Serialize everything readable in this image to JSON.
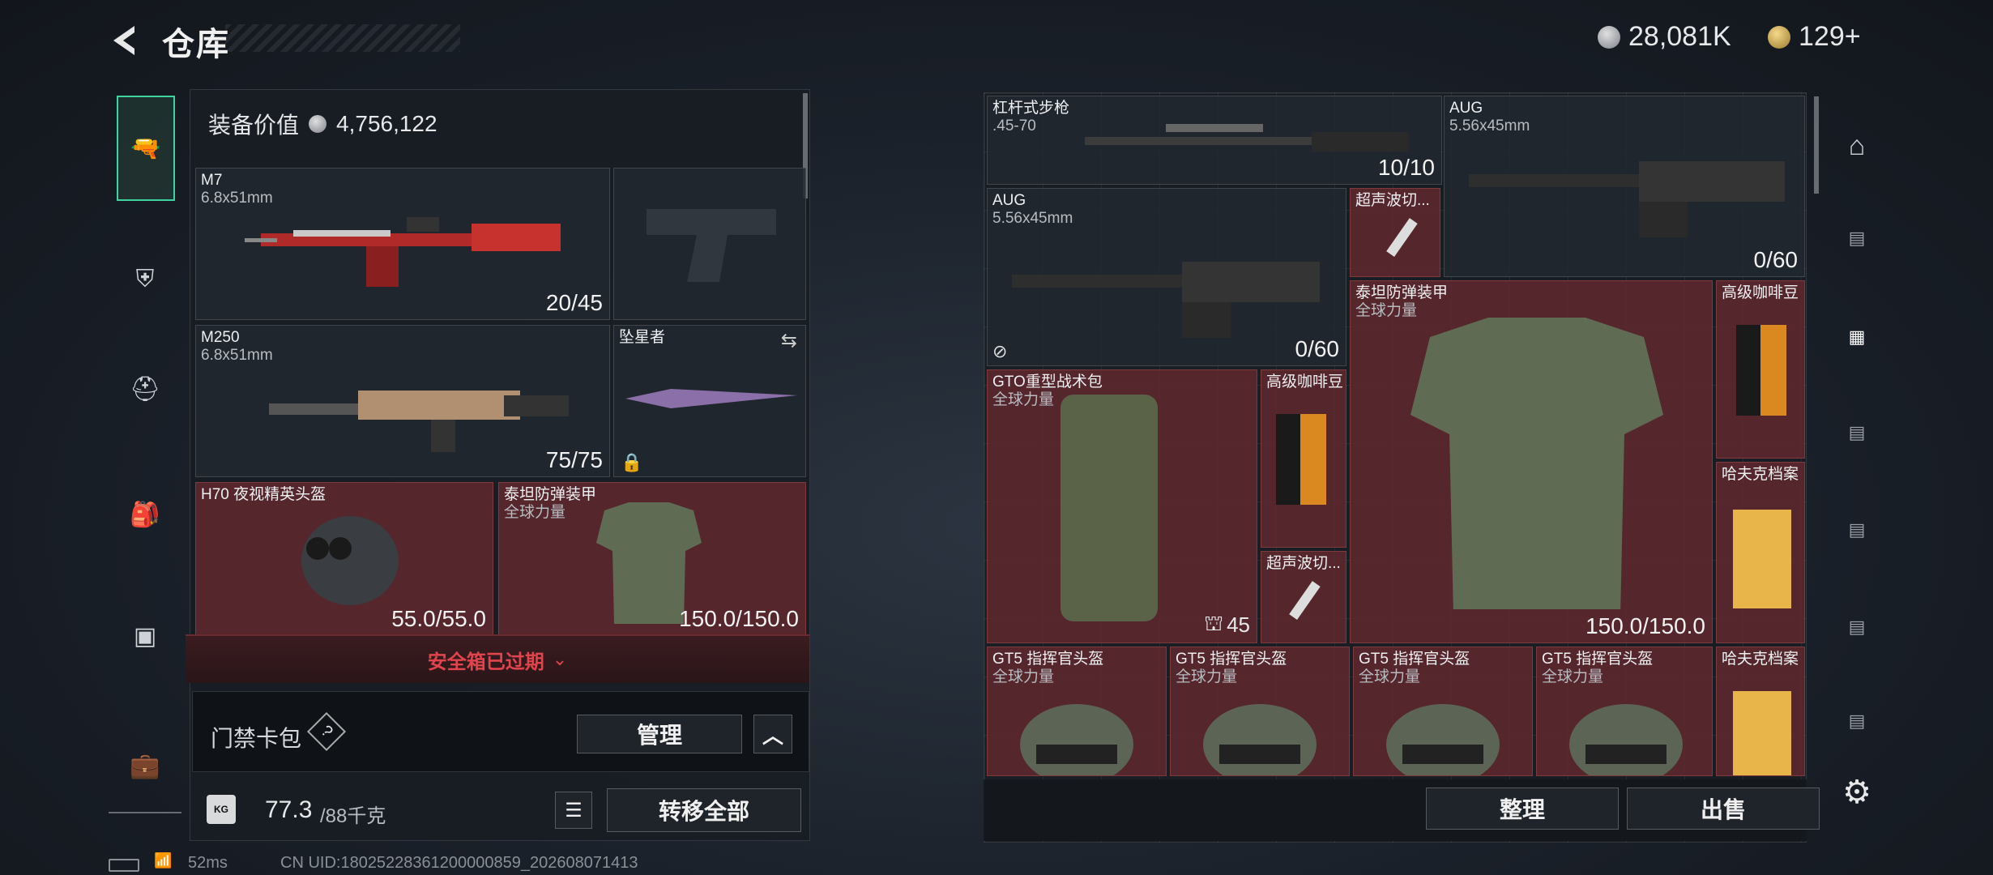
{
  "header": {
    "title": "仓库",
    "currency_silver": "28,081K",
    "currency_gold": "129+"
  },
  "loadout": {
    "value_label": "装备价值",
    "value": "4,756,122",
    "slots": [
      {
        "name": "M7",
        "sub": "6.8x51mm",
        "count": "20/45"
      },
      {
        "name": "M250",
        "sub": "6.8x51mm",
        "count": "75/75"
      },
      {
        "name": "坠星者"
      },
      {
        "name": "H70 夜视精英头盔",
        "count": "55.0/55.0"
      },
      {
        "name": "泰坦防弹装甲",
        "sub": "全球力量",
        "count": "150.0/150.0"
      }
    ],
    "secure_box_expired": "安全箱已过期",
    "access_card_label": "门禁卡包",
    "access_card_help": "?",
    "manage_label": "管理",
    "weight": "77.3",
    "weight_max": "/88千克",
    "weight_icon_label": "KG",
    "transfer_all_label": "转移全部"
  },
  "stash": {
    "items": [
      {
        "name": "杠杆式步枪",
        "sub": ".45-70",
        "count": "10/10"
      },
      {
        "name": "AUG",
        "sub": "5.56x45mm",
        "count": "0/60"
      },
      {
        "name": "AUG",
        "sub": "5.56x45mm",
        "count": "0/60"
      },
      {
        "name": "超声波切..."
      },
      {
        "name": "泰坦防弹装甲",
        "sub": "全球力量",
        "count": "150.0/150.0"
      },
      {
        "name": "高级咖啡豆"
      },
      {
        "name": "GTO重型战术包",
        "sub": "全球力量",
        "count": "45"
      },
      {
        "name": "高级咖啡豆"
      },
      {
        "name": "超声波切..."
      },
      {
        "name": "哈夫克档案"
      },
      {
        "name": "GT5 指挥官头盔",
        "sub": "全球力量"
      },
      {
        "name": "GT5 指挥官头盔",
        "sub": "全球力量"
      },
      {
        "name": "GT5 指挥官头盔",
        "sub": "全球力量"
      },
      {
        "name": "GT5 指挥官头盔",
        "sub": "全球力量"
      },
      {
        "name": "哈夫克档案"
      }
    ],
    "sort_label": "整理",
    "sell_label": "出售"
  },
  "status": {
    "ping": "52ms",
    "uid": "CN UID:18025228361200000859_202608071413"
  },
  "colors": {
    "accent": "#3fd3a0",
    "warning": "#e0444c"
  }
}
